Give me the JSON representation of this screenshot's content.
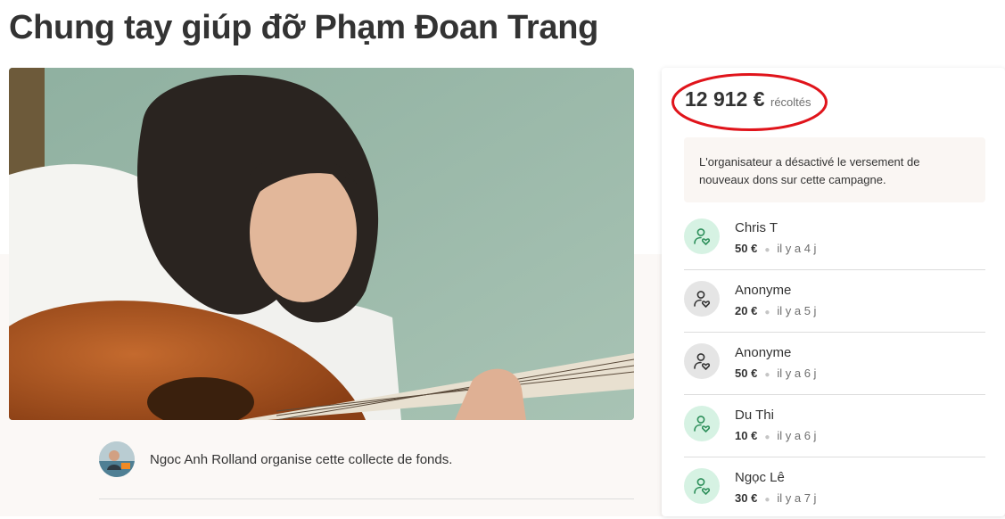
{
  "page": {
    "title": "Chung tay giúp đỡ Phạm Đoan Trang"
  },
  "organizer": {
    "text": "Ngoc Anh Rolland organise cette collecte de fonds."
  },
  "sidebar": {
    "amount": "12 912 €",
    "amount_suffix": "récoltés",
    "notice": "L'organisateur a désactivé le versement de nouveaux dons sur cette campagne.",
    "donations": [
      {
        "name": "Chris T",
        "amount": "50 €",
        "time": "il y a 4 j",
        "icon": "donor-heart-icon",
        "color": "green"
      },
      {
        "name": "Anonyme",
        "amount": "20 €",
        "time": "il y a 5 j",
        "icon": "donor-heart-icon",
        "color": "grey"
      },
      {
        "name": "Anonyme",
        "amount": "50 €",
        "time": "il y a 6 j",
        "icon": "donor-heart-icon",
        "color": "grey"
      },
      {
        "name": "Du Thi",
        "amount": "10 €",
        "time": "il y a 6 j",
        "icon": "donor-heart-icon",
        "color": "green"
      },
      {
        "name": "Ngọc Lê",
        "amount": "30 €",
        "time": "il y a 7 j",
        "icon": "donor-heart-icon",
        "color": "green"
      }
    ]
  },
  "colors": {
    "green_icon_bg": "#d6f2e3",
    "green_icon_fg": "#2d8f5a",
    "grey_icon_bg": "#e5e5e5",
    "grey_icon_fg": "#333333",
    "highlight_ring": "#e0141b",
    "notice_bg": "#faf6f3"
  }
}
